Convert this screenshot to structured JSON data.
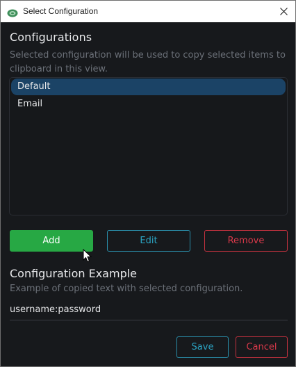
{
  "window": {
    "title": "Select Configuration",
    "app_icon": "app-logo-icon",
    "close_icon": "close-icon"
  },
  "configurations": {
    "heading": "Configurations",
    "description": "Selected configuration will be used to copy selected items to clipboard in this view.",
    "items": [
      {
        "label": "Default",
        "selected": true
      },
      {
        "label": "Email",
        "selected": false
      }
    ]
  },
  "actions": {
    "add_label": "Add",
    "edit_label": "Edit",
    "remove_label": "Remove"
  },
  "example": {
    "heading": "Configuration Example",
    "description": "Example of copied text with selected configuration.",
    "value": "username:password"
  },
  "footer": {
    "save_label": "Save",
    "cancel_label": "Cancel"
  },
  "colors": {
    "background": "#17191c",
    "accent_green": "#27a844",
    "accent_blue": "#2ba3c2",
    "accent_red": "#d9394a",
    "selection": "#1b4366"
  }
}
